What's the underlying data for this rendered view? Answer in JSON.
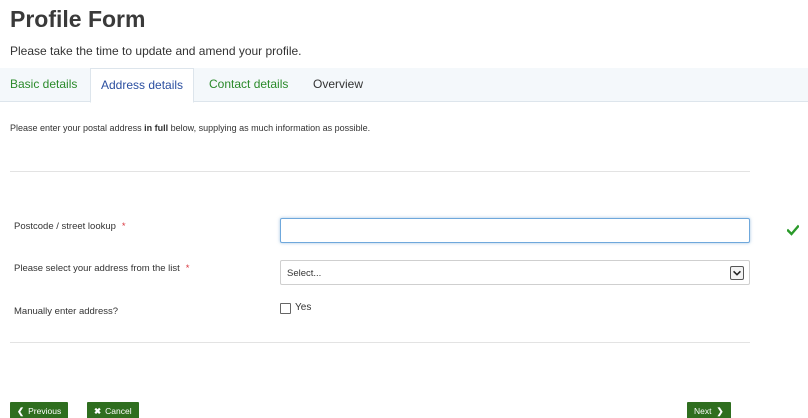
{
  "header": {
    "title": "Profile Form",
    "subtitle": "Please take the time to update and amend your profile."
  },
  "tabs": [
    {
      "label": "Basic details",
      "active": false
    },
    {
      "label": "Address details",
      "active": true
    },
    {
      "label": "Contact details",
      "active": false
    },
    {
      "label": "Overview",
      "active": false
    }
  ],
  "intro": {
    "before": "Please enter your postal address ",
    "bold": "in full",
    "after": " below, supplying as much information as possible."
  },
  "form": {
    "postcode": {
      "label": "Postcode / street lookup",
      "required_marker": "*",
      "value": "",
      "valid": true
    },
    "address_select": {
      "label": "Please select your address from the list",
      "required_marker": "*",
      "selected": "Select..."
    },
    "manual": {
      "label": "Manually enter address?",
      "option_label": "Yes",
      "checked": false
    }
  },
  "buttons": {
    "previous": "Previous",
    "cancel": "Cancel",
    "next": "Next"
  },
  "colors": {
    "accent_green": "#2f6e1f",
    "tab_link": "#2a8a2a",
    "tab_active": "#2b4fa0",
    "required": "#d9363e",
    "valid_check": "#2a9a2a"
  }
}
